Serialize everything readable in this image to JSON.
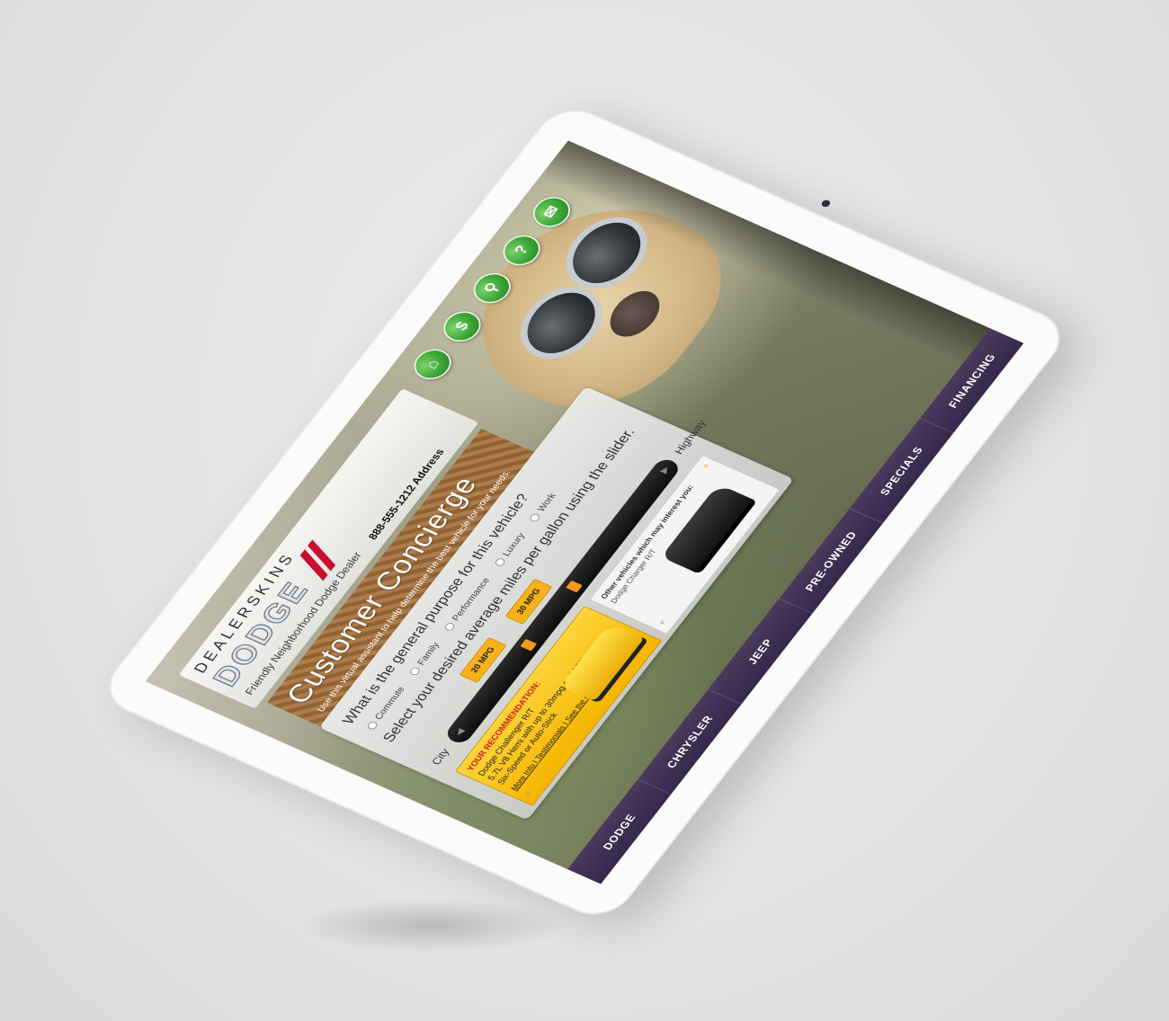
{
  "header": {
    "brand_top": "DEALERSKINS",
    "brand_dodge": "DODGE",
    "brand_sub": "Friendly Neighborhood Dodge Dealer",
    "contact": "888-555-1212 Address"
  },
  "icons": [
    {
      "name": "home-icon",
      "glyph": "⌂"
    },
    {
      "name": "dollar-icon",
      "glyph": "$"
    },
    {
      "name": "search-icon",
      "glyph": "⚲"
    },
    {
      "name": "help-icon",
      "glyph": "?"
    },
    {
      "name": "mail-icon",
      "glyph": "✉"
    }
  ],
  "banner": {
    "title": "Customer Concierge",
    "subtitle": "Use this virtual assistant to help determine the best vehicle for your needs."
  },
  "concierge": {
    "question1": "What is the general purpose for this vehicle?",
    "options": [
      "Commute",
      "Family",
      "Performance",
      "Luxury",
      "Work"
    ],
    "question2": "Select your desired average miles per gallon using the slider.",
    "mpg_low": "20 MPG",
    "mpg_high": "30 MPG",
    "label_city": "City",
    "label_highway": "Highway"
  },
  "recommendation": {
    "title": "YOUR RECOMMENDATION:",
    "line1": "Dodge Challenger R/T",
    "line2": "5.7L V8 Hemi with up to 30mpg and 376hp",
    "line3": "Six-Speed or Auto-Stick",
    "links": "More Info | Testimonials | See the car on our lot"
  },
  "others": {
    "title": "Other vehicles which may interest you:",
    "model": "Dodge Charger R/T"
  },
  "nav": [
    "DODGE",
    "CHRYSLER",
    "JEEP",
    "PRE-OWNED",
    "SPECIALS",
    "FINANCING"
  ]
}
